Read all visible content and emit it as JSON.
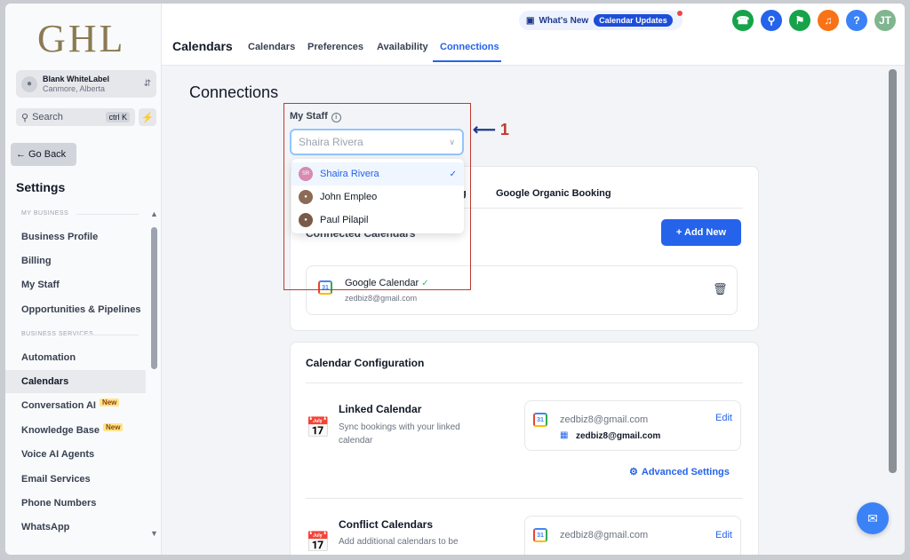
{
  "sidebar": {
    "logo": "GHL",
    "account": {
      "name": "Blank WhiteLabel",
      "location": "Canmore, Alberta"
    },
    "search": {
      "placeholder": "Search",
      "shortcut": "ctrl K"
    },
    "go_back": "Go Back",
    "settings_title": "Settings",
    "sections": [
      {
        "label": "MY BUSINESS"
      },
      {
        "label": "BUSINESS SERVICES"
      }
    ],
    "items": [
      {
        "label": "Business Profile"
      },
      {
        "label": "Billing"
      },
      {
        "label": "My Staff"
      },
      {
        "label": "Opportunities & Pipelines"
      },
      {
        "label": "Automation"
      },
      {
        "label": "Calendars",
        "active": true
      },
      {
        "label": "Conversation AI",
        "badge": "New"
      },
      {
        "label": "Knowledge Base",
        "badge": "New"
      },
      {
        "label": "Voice AI Agents"
      },
      {
        "label": "Email Services"
      },
      {
        "label": "Phone Numbers"
      },
      {
        "label": "WhatsApp"
      }
    ]
  },
  "header": {
    "title": "Calendars",
    "tabs": [
      {
        "label": "Calendars"
      },
      {
        "label": "Preferences"
      },
      {
        "label": "Availability"
      },
      {
        "label": "Connections",
        "active": true
      }
    ],
    "whats_new": "What's New",
    "calendar_updates": "Calendar Updates",
    "avatar_initials": "JT",
    "icons": [
      "phone-icon",
      "dial-icon",
      "megaphone-icon",
      "bell-icon",
      "help-icon"
    ]
  },
  "main": {
    "page_title": "Connections",
    "my_staff": {
      "label": "My Staff",
      "selected_value": "Shaira Rivera",
      "options": [
        {
          "name": "Shaira Rivera",
          "initials": "SR",
          "selected": true
        },
        {
          "name": "John Empleo"
        },
        {
          "name": "Paul Pilapil"
        }
      ]
    },
    "annotation_number": "1",
    "booking_tabs": [
      {
        "label": "g"
      },
      {
        "label": "Google Organic Booking"
      }
    ],
    "connected_calendars": {
      "label": "Connected Calendars",
      "add_new": "+ Add New",
      "items": [
        {
          "title": "Google Calendar",
          "email": "zedbiz8@gmail.com"
        }
      ]
    },
    "calendar_configuration": {
      "title": "Calendar Configuration",
      "linked": {
        "title": "Linked Calendar",
        "description": "Sync bookings with your linked calendar",
        "account_email": "zedbiz8@gmail.com",
        "calendar_email": "zedbiz8@gmail.com",
        "edit": "Edit",
        "advanced": "Advanced Settings"
      },
      "conflict": {
        "title": "Conflict Calendars",
        "description": "Add additional calendars to be",
        "account_email": "zedbiz8@gmail.com",
        "edit": "Edit"
      }
    }
  },
  "colors": {
    "primary": "#2563eb",
    "annotation": "#c0392b",
    "logo": "#8a7a52"
  }
}
